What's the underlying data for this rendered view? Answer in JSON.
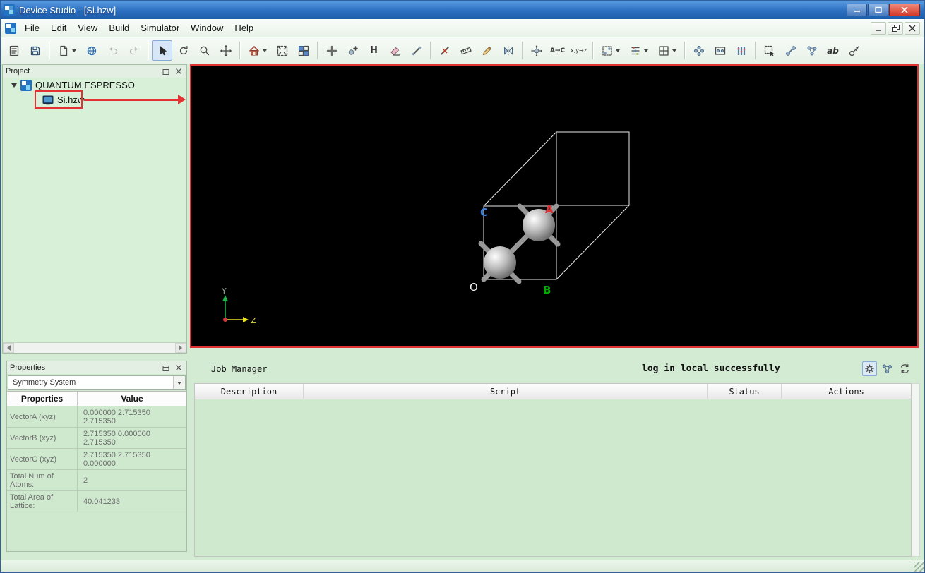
{
  "titlebar": {
    "title": "Device Studio - [Si.hzw]"
  },
  "menubar": {
    "items": [
      "File",
      "Edit",
      "View",
      "Build",
      "Simulator",
      "Window",
      "Help"
    ]
  },
  "toolbar": {
    "buttons": [
      "new-project",
      "save",
      "new-file",
      "open-workspace",
      "undo",
      "redo",
      "select",
      "rotate-view",
      "zoom",
      "pan",
      "home-view",
      "fit-view",
      "tile-windows",
      "add-atom",
      "add-fragment",
      "add-hydrogen",
      "erase",
      "draw-bond",
      "break-bond",
      "measure",
      "sketch",
      "mirror",
      "move-atoms",
      "change-element",
      "set-coordinates",
      "build-crystal",
      "align-atoms",
      "build-supercell",
      "build-cluster",
      "build-nanostructure",
      "build-heterostructure",
      "select-region",
      "bond-tool",
      "molecule-tool",
      "label-ab",
      "adjust-tool"
    ],
    "glyphs": {
      "hydrogen": "H",
      "element": "A→C",
      "coords": "x,y→z",
      "ab": "ab"
    }
  },
  "project": {
    "title": "Project",
    "root": "QUANTUM ESPRESSO",
    "file": "Si.hzw"
  },
  "viewport": {
    "axis_a": "A",
    "axis_b": "B",
    "axis_c": "C",
    "origin": "O",
    "triad_y": "Y",
    "triad_z": "Z"
  },
  "properties": {
    "title": "Properties",
    "selector": "Symmetry System",
    "columns": [
      "Properties",
      "Value"
    ],
    "rows": [
      {
        "name": "VectorA (xyz)",
        "value": "0.000000 2.715350 2.715350"
      },
      {
        "name": "VectorB (xyz)",
        "value": "2.715350 0.000000 2.715350"
      },
      {
        "name": "VectorC (xyz)",
        "value": "2.715350 2.715350 0.000000"
      },
      {
        "name": "Total Num of Atoms:",
        "value": "2"
      },
      {
        "name": "Total Area of Lattice:",
        "value": "40.041233"
      }
    ]
  },
  "job_manager": {
    "title": "Job Manager",
    "status": "log in local successfully",
    "columns": [
      "Description",
      "Script",
      "Status",
      "Actions"
    ]
  }
}
